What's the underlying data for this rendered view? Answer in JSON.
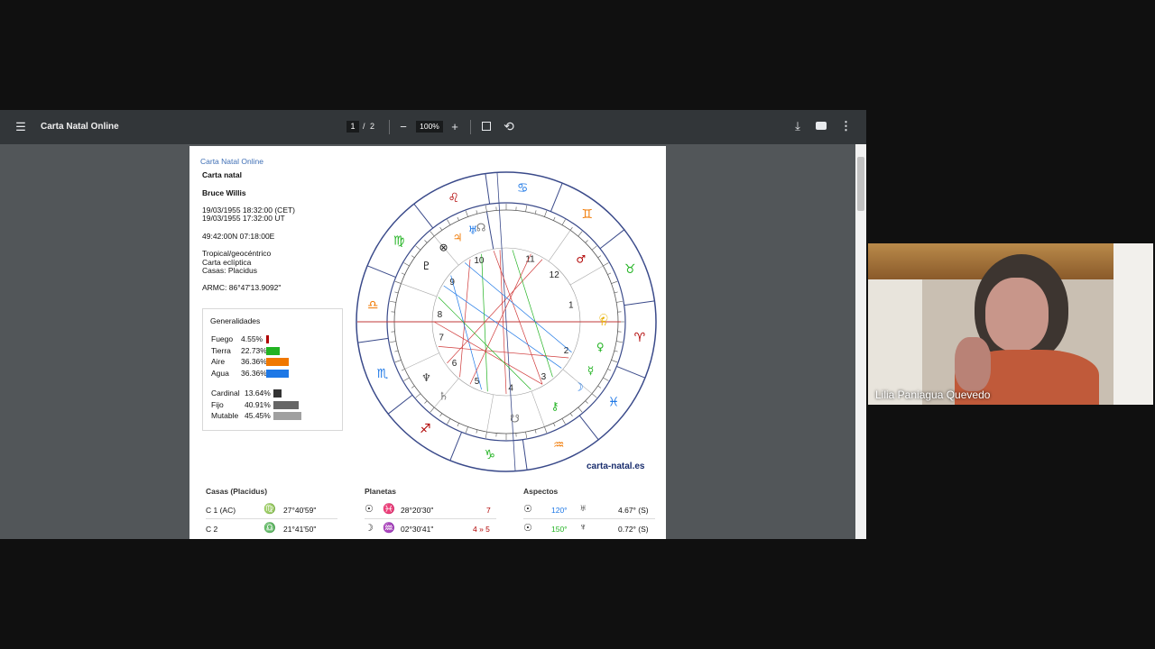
{
  "viewer": {
    "title": "Carta Natal Online",
    "page_current": "1",
    "page_separator": "/",
    "page_total": "2",
    "zoom": "100%",
    "icons": {
      "menu": "menu-icon",
      "zoom_out": "minus-icon",
      "zoom_in": "plus-icon",
      "fit": "fit-page-icon",
      "rotate": "rotate-icon",
      "download": "download-icon",
      "print": "print-icon",
      "more": "more-vert-icon"
    }
  },
  "document": {
    "header_link": "Carta Natal Online",
    "title": "Carta natal",
    "name": "Bruce Willis",
    "datetime_local": "19/03/1955 18:32:00 (CET)",
    "datetime_ut": "19/03/1955 17:32:00 UT",
    "coords": "49:42:00N 07:18:00E",
    "system1": "Tropical/geocéntrico",
    "system2": "Carta eclíptica",
    "system3": "Casas: Placidus",
    "armc": "ARMC: 86°47'13.9092\"",
    "generalidades": {
      "title": "Generalidades",
      "elements": [
        {
          "label": "Fuego",
          "value": "4.55%",
          "pct": 4.55,
          "color": "#b00000"
        },
        {
          "label": "Tierra",
          "value": "22.73%",
          "pct": 22.73,
          "color": "#22b322"
        },
        {
          "label": "Aire",
          "value": "36.36%",
          "pct": 36.36,
          "color": "#f07800"
        },
        {
          "label": "Agua",
          "value": "36.36%",
          "pct": 36.36,
          "color": "#1e78e6"
        }
      ],
      "modes": [
        {
          "label": "Cardinal",
          "value": "13.64%",
          "pct": 13.64,
          "color": "#333333"
        },
        {
          "label": "Fijo",
          "value": "40.91%",
          "pct": 40.91,
          "color": "#666666"
        },
        {
          "label": "Mutable",
          "value": "45.45%",
          "pct": 45.45,
          "color": "#a0a0a0"
        }
      ]
    },
    "wheel": {
      "site": "carta-natal.es",
      "houses": [
        "10",
        "9",
        "8",
        "7",
        "6",
        "5",
        "4",
        "3",
        "2",
        "1",
        "12",
        "11"
      ],
      "signs": [
        {
          "glyph": "♋",
          "color": "#1e78e6"
        },
        {
          "glyph": "♊",
          "color": "#f07800"
        },
        {
          "glyph": "♉",
          "color": "#22b322"
        },
        {
          "glyph": "♈",
          "color": "#b00000"
        },
        {
          "glyph": "♓",
          "color": "#1e78e6"
        },
        {
          "glyph": "♒",
          "color": "#f07800"
        },
        {
          "glyph": "♑",
          "color": "#22b322"
        },
        {
          "glyph": "♐",
          "color": "#b00000"
        },
        {
          "glyph": "♏",
          "color": "#1e78e6"
        },
        {
          "glyph": "♎",
          "color": "#f07800"
        },
        {
          "glyph": "♍",
          "color": "#22b322"
        },
        {
          "glyph": "♌",
          "color": "#b00000"
        }
      ],
      "planets": [
        {
          "glyph": "☉",
          "color": "#e8b000"
        },
        {
          "glyph": "♀",
          "color": "#22b322"
        },
        {
          "glyph": "☿",
          "color": "#22b322"
        },
        {
          "glyph": "♂",
          "color": "#b00000"
        },
        {
          "glyph": "☽",
          "color": "#1e78e6"
        },
        {
          "glyph": "♅",
          "color": "#1e78e6"
        },
        {
          "glyph": "♃",
          "color": "#f07800"
        },
        {
          "glyph": "⊗",
          "color": "#111111"
        },
        {
          "glyph": "♇",
          "color": "#111111"
        },
        {
          "glyph": "♆",
          "color": "#444444"
        },
        {
          "glyph": "☊",
          "color": "#777777"
        },
        {
          "glyph": "♄",
          "color": "#777777"
        },
        {
          "glyph": "☋",
          "color": "#777777"
        },
        {
          "glyph": "⚷",
          "color": "#22b322"
        },
        {
          "glyph": "♄",
          "color": "#e8b000"
        }
      ]
    },
    "tables": {
      "casas": {
        "title": "Casas (Placidus)",
        "rows": [
          {
            "house": "C 1 (AC)",
            "sign": "♍",
            "sign_color": "#22b322",
            "deg": "27°40'59\""
          },
          {
            "house": "C 2",
            "sign": "♎",
            "sign_color": "#f07800",
            "deg": "21°41'50\""
          }
        ]
      },
      "planetas": {
        "title": "Planetas",
        "rows": [
          {
            "planet": "☉",
            "sign": "♓",
            "sign_color": "#1e78e6",
            "deg": "28°20'30\"",
            "house": "7"
          },
          {
            "planet": "☽",
            "sign": "♒",
            "sign_color": "#f07800",
            "deg": "02°30'41\"",
            "house": "4 » 5"
          }
        ]
      },
      "aspectos": {
        "title": "Aspectos",
        "rows": [
          {
            "p1": "☉",
            "angle": "120°",
            "angle_color": "#1e78e6",
            "p2": "♅",
            "orb": "4.67° (S)"
          },
          {
            "p1": "☉",
            "angle": "150°",
            "angle_color": "#22b322",
            "p2": "♆",
            "orb": "0.72° (S)"
          }
        ]
      }
    }
  },
  "webcam": {
    "participant": "Lilia Paniagua Quevedo"
  }
}
